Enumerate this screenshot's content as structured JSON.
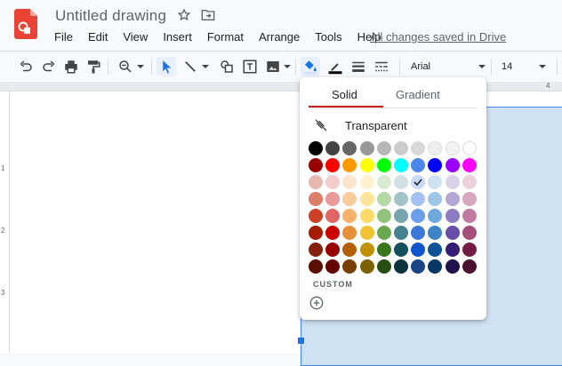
{
  "app": {
    "title": "Untitled drawing",
    "icon": "drawings-logo",
    "brand_color": "#ea4335",
    "save_status": "All changes saved in Drive"
  },
  "menu": [
    "File",
    "Edit",
    "View",
    "Insert",
    "Format",
    "Arrange",
    "Tools",
    "Help"
  ],
  "toolbar": {
    "font": "Arial",
    "font_size": "14",
    "buttons": [
      "undo-icon",
      "redo-icon",
      "print-icon",
      "paint-format-icon",
      "zoom-icon",
      "select-icon",
      "line-icon",
      "shape-icon",
      "textbox-icon",
      "image-icon",
      "fill-color-icon",
      "border-color-icon",
      "border-weight-icon",
      "border-dash-icon"
    ]
  },
  "ruler": {
    "h_label": "4",
    "v_labels": [
      "1",
      "2",
      "3"
    ]
  },
  "color_picker": {
    "tab_solid": "Solid",
    "tab_gradient": "Gradient",
    "transparent_label": "Transparent",
    "custom_label": "CUSTOM",
    "selected": "#c9daf8",
    "rows": [
      [
        "#000000",
        "#434343",
        "#666666",
        "#999999",
        "#b7b7b7",
        "#cccccc",
        "#d9d9d9",
        "#efefef",
        "#f3f3f3",
        "#ffffff"
      ],
      [
        "#980000",
        "#ff0000",
        "#ff9900",
        "#ffff00",
        "#00ff00",
        "#00ffff",
        "#4a86e8",
        "#0000ff",
        "#9900ff",
        "#ff00ff"
      ],
      [
        "#e6b8af",
        "#f4cccc",
        "#fce5cd",
        "#fff2cc",
        "#d9ead3",
        "#d0e0e3",
        "#c9daf8",
        "#cfe2f3",
        "#d9d2e9",
        "#ead1dc"
      ],
      [
        "#dd7e6b",
        "#ea9999",
        "#f9cb9c",
        "#ffe599",
        "#b6d7a8",
        "#a2c4c9",
        "#a4c2f4",
        "#9fc5e8",
        "#b4a7d6",
        "#d5a6bd"
      ],
      [
        "#cc4125",
        "#e06666",
        "#f6b26b",
        "#ffd966",
        "#93c47d",
        "#76a5af",
        "#6d9eeb",
        "#6fa8dc",
        "#8e7cc3",
        "#c27ba0"
      ],
      [
        "#a61c00",
        "#cc0000",
        "#e69138",
        "#f1c232",
        "#6aa84f",
        "#45818e",
        "#3c78d8",
        "#3d85c6",
        "#674ea7",
        "#a64d79"
      ],
      [
        "#85200c",
        "#990000",
        "#b45f06",
        "#bf9000",
        "#38761d",
        "#134f5c",
        "#1155cc",
        "#0b5394",
        "#351c75",
        "#741b47"
      ],
      [
        "#5b0f00",
        "#660000",
        "#783f04",
        "#7f6000",
        "#274e13",
        "#0c343d",
        "#1c4587",
        "#073763",
        "#20124d",
        "#4c1130"
      ]
    ]
  }
}
